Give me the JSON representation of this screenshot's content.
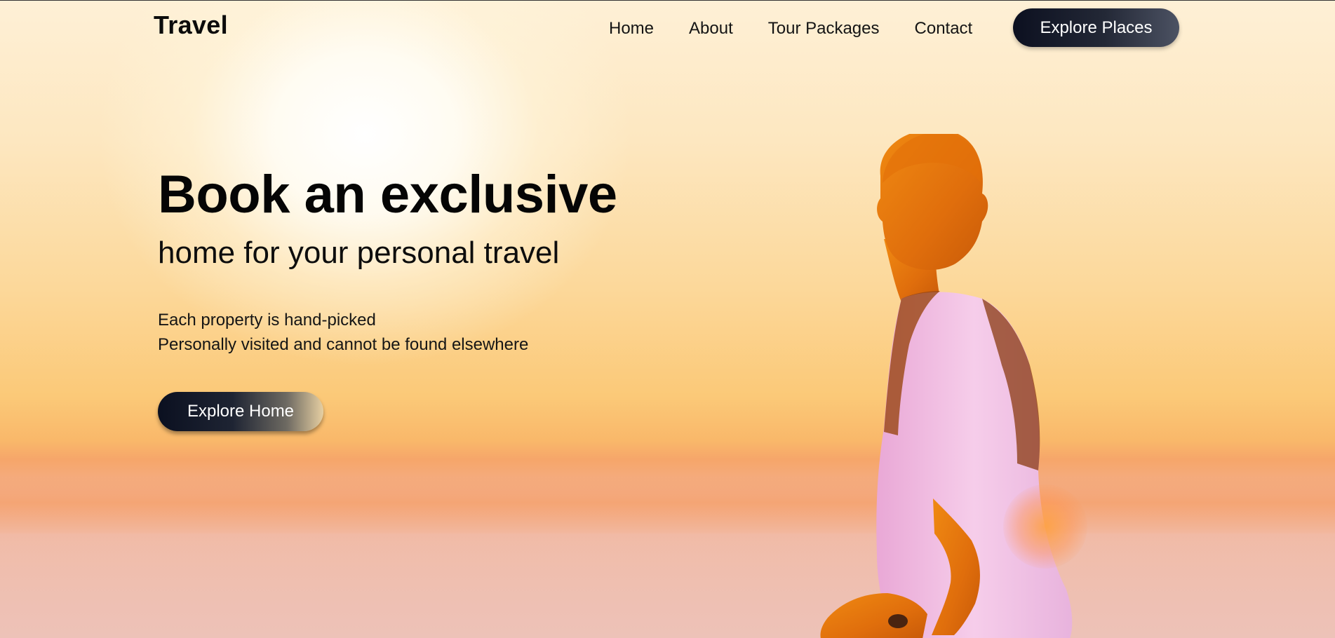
{
  "header": {
    "brand": "Travel",
    "nav": {
      "home": "Home",
      "about": "About",
      "tour_packages": "Tour Packages",
      "contact": "Contact"
    },
    "cta_label": "Explore Places"
  },
  "hero": {
    "title": "Book an exclusive",
    "subtitle": "home for your personal travel",
    "desc_line1": "Each property is hand-picked",
    "desc_line2": "Personally visited and cannot be found elsewhere",
    "cta_label": "Explore Home"
  },
  "colors": {
    "accent_dark": "#0c1020",
    "sky_top": "#fef0d6",
    "sky_mid": "#fbc978",
    "horizon": "#f6a66a",
    "shirt": "#f2c6e8",
    "skin": "#e47a10"
  },
  "image": {
    "hero_photo": "person-looking-at-sunset"
  }
}
